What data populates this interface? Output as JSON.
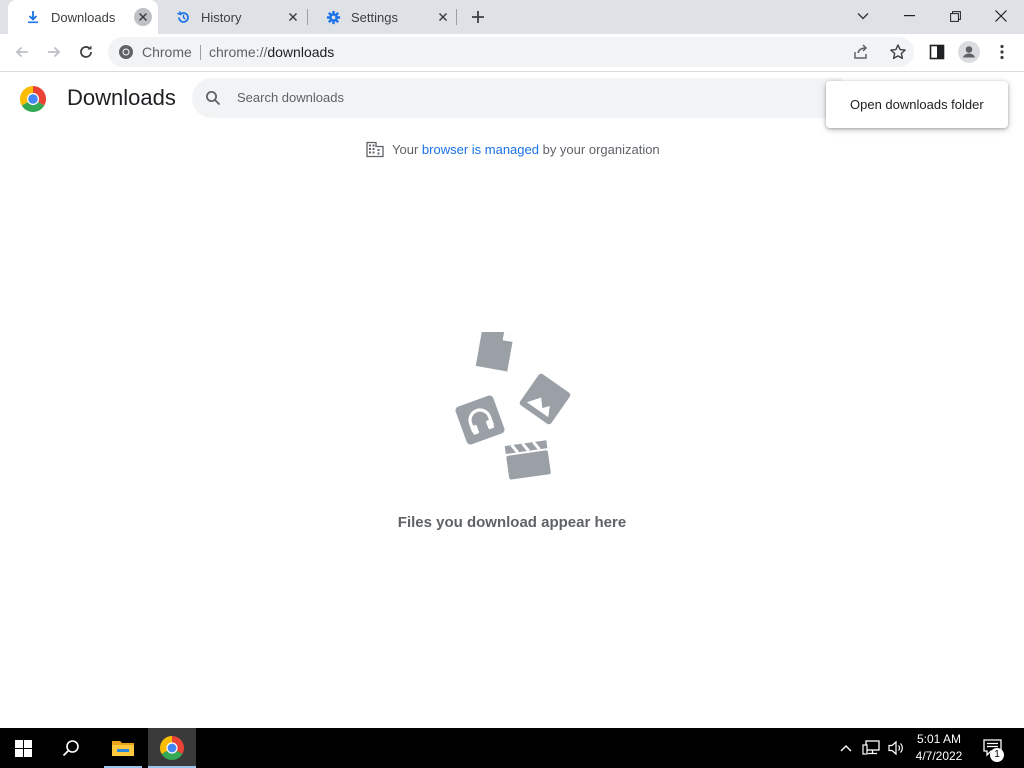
{
  "tabs": [
    {
      "label": "Downloads",
      "icon": "download-icon",
      "active": true
    },
    {
      "label": "History",
      "icon": "history-icon",
      "active": false
    },
    {
      "label": "Settings",
      "icon": "gear-icon",
      "active": false
    }
  ],
  "omnibox": {
    "site_label": "Chrome",
    "url_prefix": "chrome://",
    "url_path": "downloads"
  },
  "page": {
    "title": "Downloads",
    "search_placeholder": "Search downloads",
    "open_folder_label": "Open downloads folder",
    "managed_prefix": "Your",
    "managed_link": "browser is managed",
    "managed_suffix": "by your organization",
    "empty_message": "Files you download appear here"
  },
  "taskbar": {
    "time": "5:01 AM",
    "date": "4/7/2022",
    "notification_count": "1"
  },
  "colors": {
    "accent": "#1a73e8",
    "tabstrip": "#dee1e6",
    "taskbar": "#000000"
  }
}
